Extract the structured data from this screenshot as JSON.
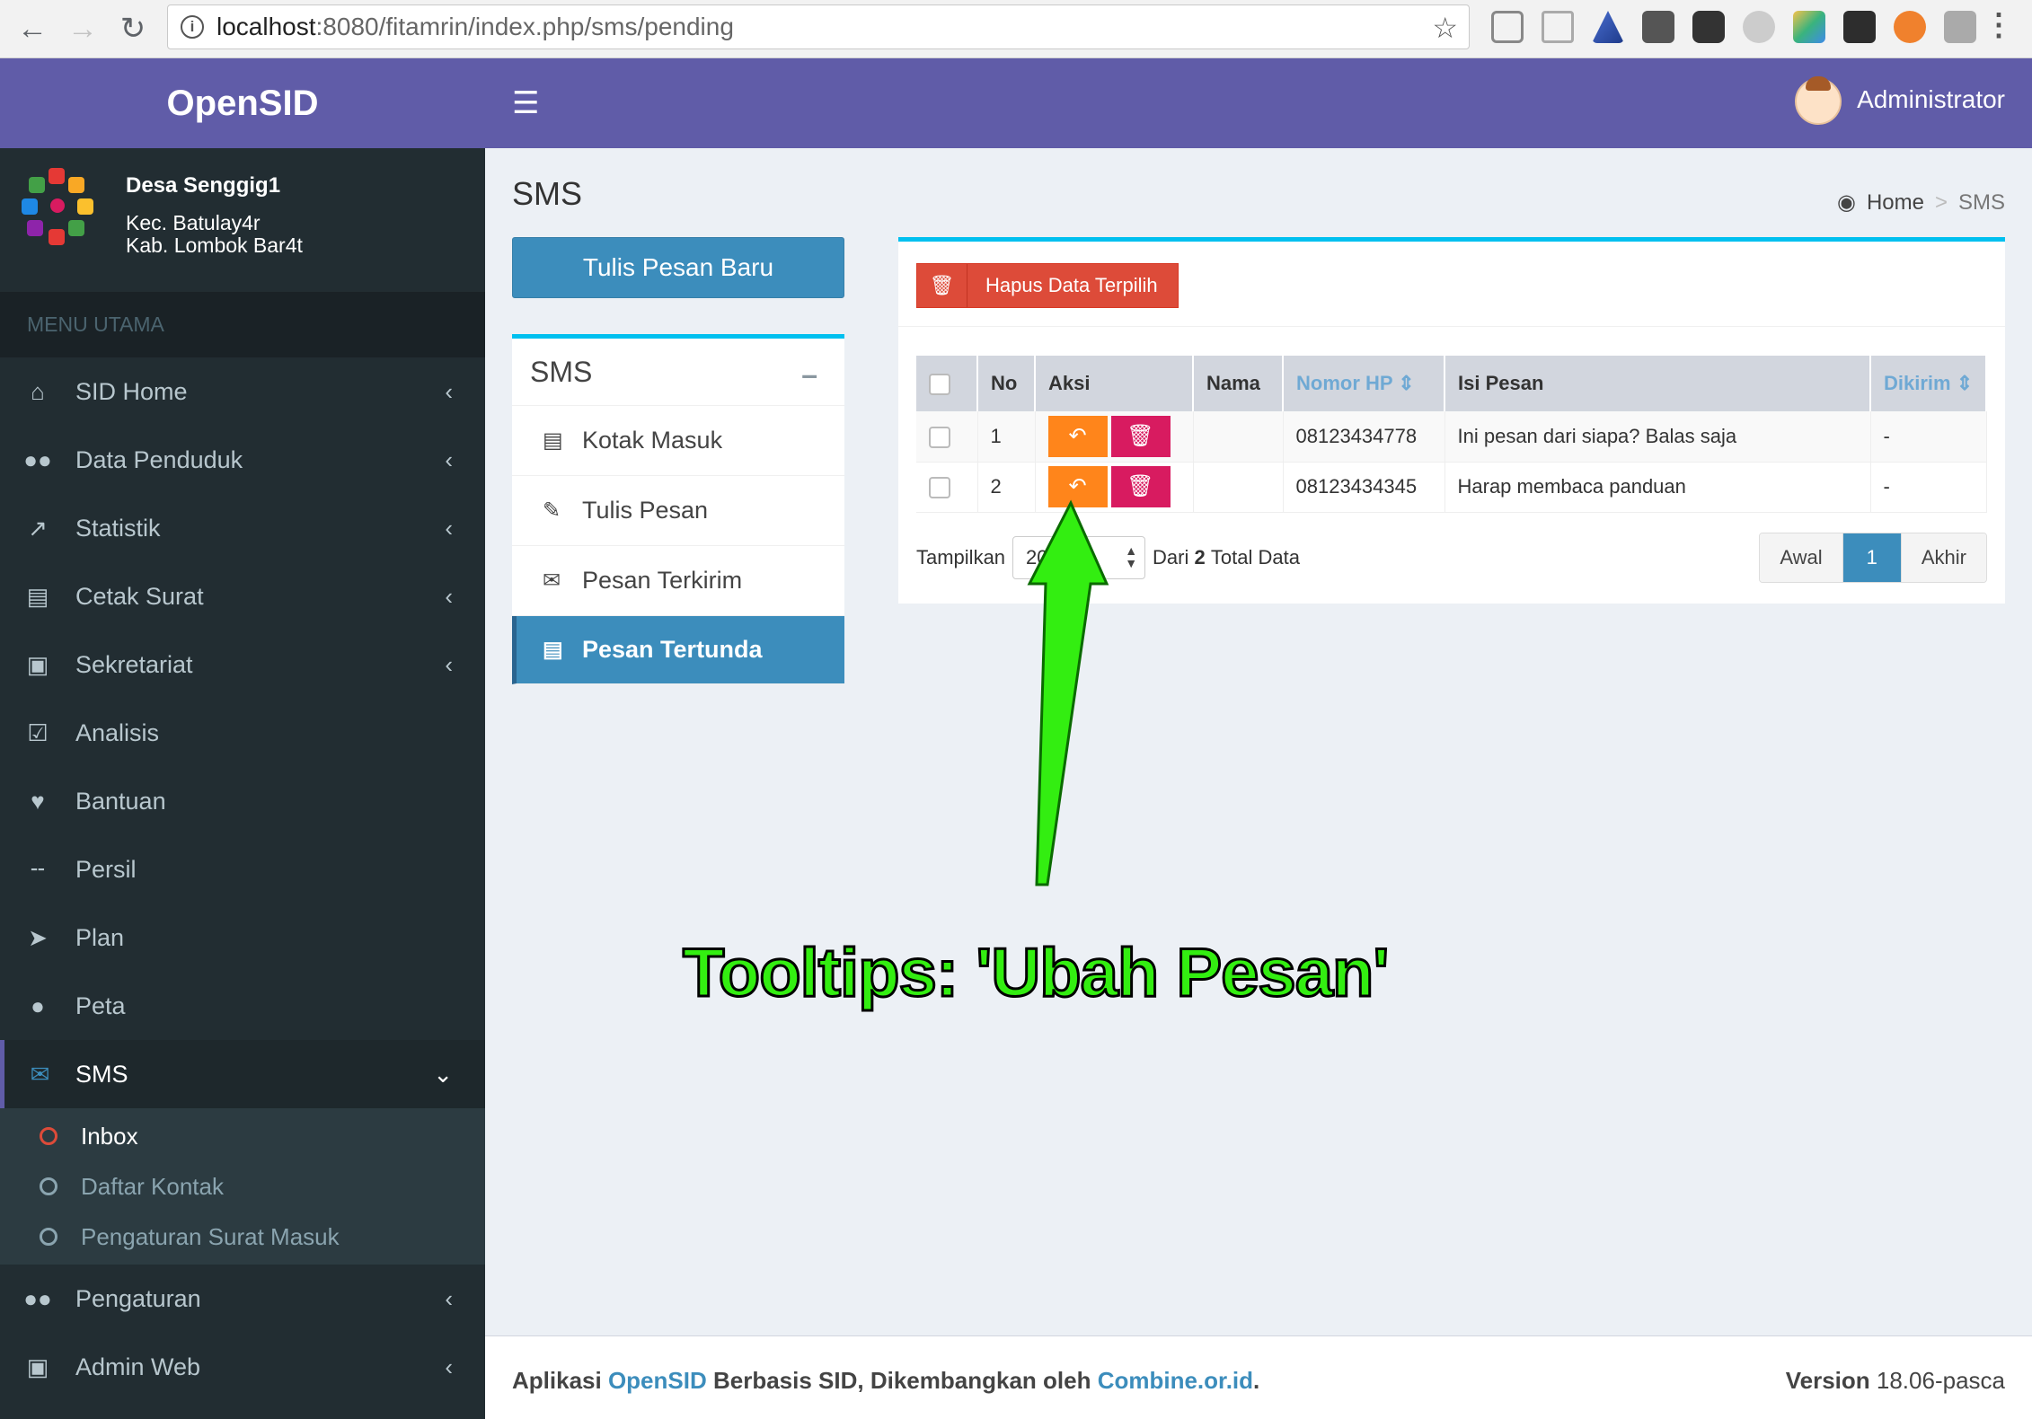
{
  "browser": {
    "url_host": "localhost",
    "url_rest": ":8080/fitamrin/index.php/sms/pending"
  },
  "app": {
    "brand": "OpenSID",
    "user_name": "Administrator"
  },
  "sidebar": {
    "desa_name": "Desa Senggig1",
    "kecamatan": "Kec. Batulay4r",
    "kabupaten": "Kab. Lombok Bar4t",
    "menu_header": "MENU UTAMA",
    "items": [
      {
        "label": "SID Home",
        "icon": "home-icon"
      },
      {
        "label": "Data Penduduk",
        "icon": "users-icon"
      },
      {
        "label": "Statistik",
        "icon": "chart-icon"
      },
      {
        "label": "Cetak Surat",
        "icon": "book-icon"
      },
      {
        "label": "Sekretariat",
        "icon": "archive-icon"
      },
      {
        "label": "Analisis",
        "icon": "check-square-icon"
      },
      {
        "label": "Bantuan",
        "icon": "heart-icon"
      },
      {
        "label": "Persil",
        "icon": "signpost-icon"
      },
      {
        "label": "Plan",
        "icon": "location-arrow-icon"
      },
      {
        "label": "Peta",
        "icon": "globe-icon"
      },
      {
        "label": "SMS",
        "icon": "envelope-icon"
      },
      {
        "label": "Pengaturan",
        "icon": "users-cog-icon"
      },
      {
        "label": "Admin Web",
        "icon": "desktop-icon"
      }
    ],
    "sms_sub": [
      {
        "label": "Inbox"
      },
      {
        "label": "Daftar Kontak"
      },
      {
        "label": "Pengaturan Surat Masuk"
      }
    ]
  },
  "content": {
    "page_title": "SMS",
    "breadcrumb_home": "Home",
    "breadcrumb_sep": ">",
    "breadcrumb_current": "SMS",
    "new_button": "Tulis Pesan Baru",
    "box_title": "SMS",
    "nav": [
      {
        "label": "Kotak Masuk"
      },
      {
        "label": "Tulis Pesan"
      },
      {
        "label": "Pesan Terkirim"
      },
      {
        "label": "Pesan Tertunda"
      }
    ],
    "delete_selected": "Hapus Data Terpilih"
  },
  "table": {
    "headers": {
      "no": "No",
      "aksi": "Aksi",
      "nama": "Nama",
      "nomor": "Nomor HP",
      "isi": "Isi Pesan",
      "dikirim": "Dikirim"
    },
    "rows": [
      {
        "no": "1",
        "nama": "",
        "nomor": "08123434778",
        "isi": "Ini pesan dari siapa? Balas saja",
        "dikirim": "-"
      },
      {
        "no": "2",
        "nama": "",
        "nomor": "08123434345",
        "isi": "Harap membaca panduan",
        "dikirim": "-"
      }
    ]
  },
  "paging": {
    "show_label": "Tampilkan",
    "per_page": "20",
    "from_label": "Dari",
    "total": "2",
    "total_label": "Total Data",
    "first": "Awal",
    "current": "1",
    "last": "Akhir"
  },
  "annotation": {
    "text": "Tooltips: 'Ubah Pesan'",
    "color": "#33ee11"
  },
  "footer": {
    "prefix": "Aplikasi",
    "app_link": "OpenSID",
    "middle": "Berbasis SID, Dikembangkan oleh",
    "org_link": "Combine.or.id",
    "end": ".",
    "version_label": "Version",
    "version": "18.06-pasca"
  }
}
